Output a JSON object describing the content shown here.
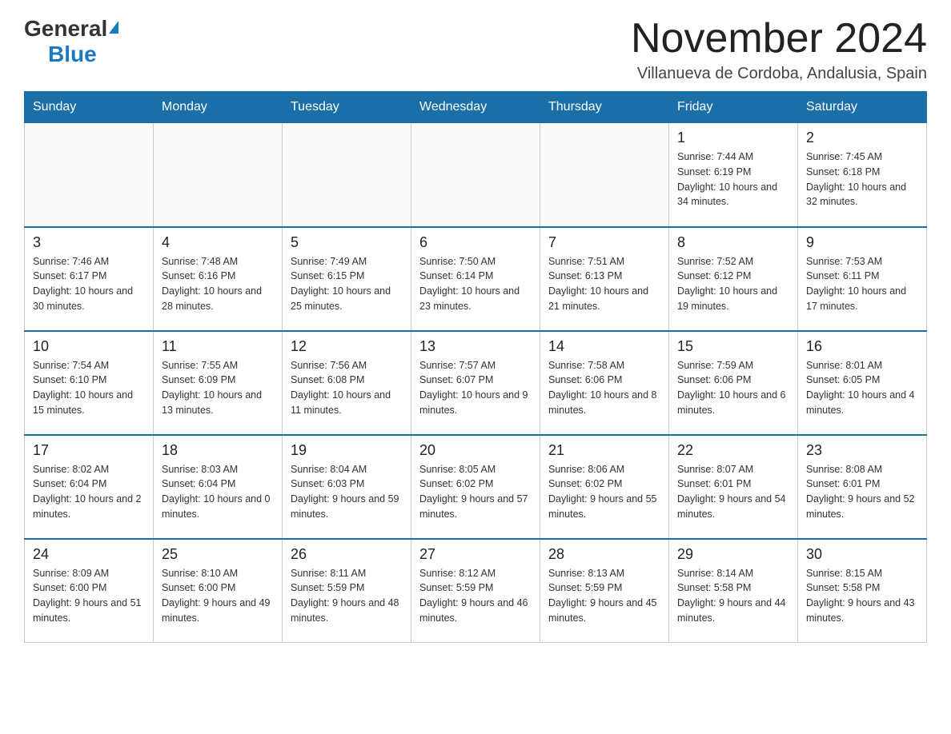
{
  "header": {
    "logo_general": "General",
    "logo_blue": "Blue",
    "month_title": "November 2024",
    "location": "Villanueva de Cordoba, Andalusia, Spain"
  },
  "weekdays": [
    "Sunday",
    "Monday",
    "Tuesday",
    "Wednesday",
    "Thursday",
    "Friday",
    "Saturday"
  ],
  "weeks": [
    [
      {
        "day": "",
        "sunrise": "",
        "sunset": "",
        "daylight": ""
      },
      {
        "day": "",
        "sunrise": "",
        "sunset": "",
        "daylight": ""
      },
      {
        "day": "",
        "sunrise": "",
        "sunset": "",
        "daylight": ""
      },
      {
        "day": "",
        "sunrise": "",
        "sunset": "",
        "daylight": ""
      },
      {
        "day": "",
        "sunrise": "",
        "sunset": "",
        "daylight": ""
      },
      {
        "day": "1",
        "sunrise": "Sunrise: 7:44 AM",
        "sunset": "Sunset: 6:19 PM",
        "daylight": "Daylight: 10 hours and 34 minutes."
      },
      {
        "day": "2",
        "sunrise": "Sunrise: 7:45 AM",
        "sunset": "Sunset: 6:18 PM",
        "daylight": "Daylight: 10 hours and 32 minutes."
      }
    ],
    [
      {
        "day": "3",
        "sunrise": "Sunrise: 7:46 AM",
        "sunset": "Sunset: 6:17 PM",
        "daylight": "Daylight: 10 hours and 30 minutes."
      },
      {
        "day": "4",
        "sunrise": "Sunrise: 7:48 AM",
        "sunset": "Sunset: 6:16 PM",
        "daylight": "Daylight: 10 hours and 28 minutes."
      },
      {
        "day": "5",
        "sunrise": "Sunrise: 7:49 AM",
        "sunset": "Sunset: 6:15 PM",
        "daylight": "Daylight: 10 hours and 25 minutes."
      },
      {
        "day": "6",
        "sunrise": "Sunrise: 7:50 AM",
        "sunset": "Sunset: 6:14 PM",
        "daylight": "Daylight: 10 hours and 23 minutes."
      },
      {
        "day": "7",
        "sunrise": "Sunrise: 7:51 AM",
        "sunset": "Sunset: 6:13 PM",
        "daylight": "Daylight: 10 hours and 21 minutes."
      },
      {
        "day": "8",
        "sunrise": "Sunrise: 7:52 AM",
        "sunset": "Sunset: 6:12 PM",
        "daylight": "Daylight: 10 hours and 19 minutes."
      },
      {
        "day": "9",
        "sunrise": "Sunrise: 7:53 AM",
        "sunset": "Sunset: 6:11 PM",
        "daylight": "Daylight: 10 hours and 17 minutes."
      }
    ],
    [
      {
        "day": "10",
        "sunrise": "Sunrise: 7:54 AM",
        "sunset": "Sunset: 6:10 PM",
        "daylight": "Daylight: 10 hours and 15 minutes."
      },
      {
        "day": "11",
        "sunrise": "Sunrise: 7:55 AM",
        "sunset": "Sunset: 6:09 PM",
        "daylight": "Daylight: 10 hours and 13 minutes."
      },
      {
        "day": "12",
        "sunrise": "Sunrise: 7:56 AM",
        "sunset": "Sunset: 6:08 PM",
        "daylight": "Daylight: 10 hours and 11 minutes."
      },
      {
        "day": "13",
        "sunrise": "Sunrise: 7:57 AM",
        "sunset": "Sunset: 6:07 PM",
        "daylight": "Daylight: 10 hours and 9 minutes."
      },
      {
        "day": "14",
        "sunrise": "Sunrise: 7:58 AM",
        "sunset": "Sunset: 6:06 PM",
        "daylight": "Daylight: 10 hours and 8 minutes."
      },
      {
        "day": "15",
        "sunrise": "Sunrise: 7:59 AM",
        "sunset": "Sunset: 6:06 PM",
        "daylight": "Daylight: 10 hours and 6 minutes."
      },
      {
        "day": "16",
        "sunrise": "Sunrise: 8:01 AM",
        "sunset": "Sunset: 6:05 PM",
        "daylight": "Daylight: 10 hours and 4 minutes."
      }
    ],
    [
      {
        "day": "17",
        "sunrise": "Sunrise: 8:02 AM",
        "sunset": "Sunset: 6:04 PM",
        "daylight": "Daylight: 10 hours and 2 minutes."
      },
      {
        "day": "18",
        "sunrise": "Sunrise: 8:03 AM",
        "sunset": "Sunset: 6:04 PM",
        "daylight": "Daylight: 10 hours and 0 minutes."
      },
      {
        "day": "19",
        "sunrise": "Sunrise: 8:04 AM",
        "sunset": "Sunset: 6:03 PM",
        "daylight": "Daylight: 9 hours and 59 minutes."
      },
      {
        "day": "20",
        "sunrise": "Sunrise: 8:05 AM",
        "sunset": "Sunset: 6:02 PM",
        "daylight": "Daylight: 9 hours and 57 minutes."
      },
      {
        "day": "21",
        "sunrise": "Sunrise: 8:06 AM",
        "sunset": "Sunset: 6:02 PM",
        "daylight": "Daylight: 9 hours and 55 minutes."
      },
      {
        "day": "22",
        "sunrise": "Sunrise: 8:07 AM",
        "sunset": "Sunset: 6:01 PM",
        "daylight": "Daylight: 9 hours and 54 minutes."
      },
      {
        "day": "23",
        "sunrise": "Sunrise: 8:08 AM",
        "sunset": "Sunset: 6:01 PM",
        "daylight": "Daylight: 9 hours and 52 minutes."
      }
    ],
    [
      {
        "day": "24",
        "sunrise": "Sunrise: 8:09 AM",
        "sunset": "Sunset: 6:00 PM",
        "daylight": "Daylight: 9 hours and 51 minutes."
      },
      {
        "day": "25",
        "sunrise": "Sunrise: 8:10 AM",
        "sunset": "Sunset: 6:00 PM",
        "daylight": "Daylight: 9 hours and 49 minutes."
      },
      {
        "day": "26",
        "sunrise": "Sunrise: 8:11 AM",
        "sunset": "Sunset: 5:59 PM",
        "daylight": "Daylight: 9 hours and 48 minutes."
      },
      {
        "day": "27",
        "sunrise": "Sunrise: 8:12 AM",
        "sunset": "Sunset: 5:59 PM",
        "daylight": "Daylight: 9 hours and 46 minutes."
      },
      {
        "day": "28",
        "sunrise": "Sunrise: 8:13 AM",
        "sunset": "Sunset: 5:59 PM",
        "daylight": "Daylight: 9 hours and 45 minutes."
      },
      {
        "day": "29",
        "sunrise": "Sunrise: 8:14 AM",
        "sunset": "Sunset: 5:58 PM",
        "daylight": "Daylight: 9 hours and 44 minutes."
      },
      {
        "day": "30",
        "sunrise": "Sunrise: 8:15 AM",
        "sunset": "Sunset: 5:58 PM",
        "daylight": "Daylight: 9 hours and 43 minutes."
      }
    ]
  ]
}
